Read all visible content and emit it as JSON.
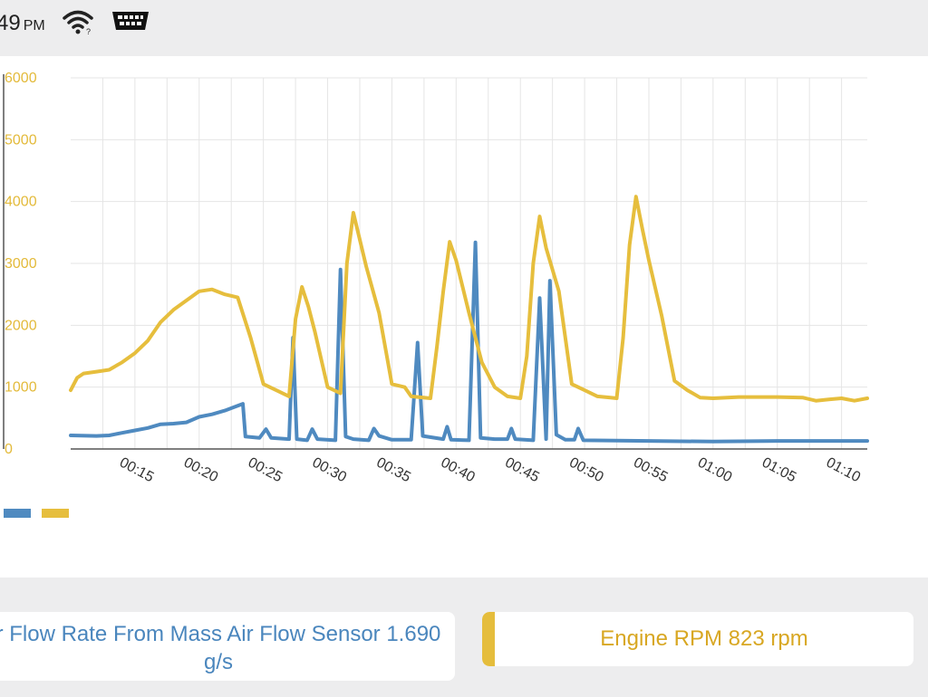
{
  "status_bar": {
    "time": "49",
    "ampm": "PM",
    "icons": [
      "wifi-icon",
      "obd-connector-icon"
    ]
  },
  "colors": {
    "maf": "#4f8ac0",
    "rpm": "#e6be3d",
    "rpm_text": "#d8a722",
    "maf_text": "#4a86bd",
    "grid": "#e5e5e5",
    "tick_text": "#e3ba3a"
  },
  "chart_data": {
    "type": "line",
    "x_ticks": [
      "00:15",
      "00:20",
      "00:25",
      "00:30",
      "00:35",
      "00:40",
      "00:45",
      "00:50",
      "00:55",
      "01:00",
      "01:05",
      "01:10"
    ],
    "y_ticks": [
      "0",
      "1000",
      "2000",
      "3000",
      "4000",
      "5000",
      "6000"
    ],
    "ylim": [
      0,
      6000
    ],
    "xlim": [
      "00:10",
      "01:12"
    ],
    "grid": true,
    "legend": "bottom-left",
    "series": [
      {
        "key": "maf",
        "points": [
          [
            "00:10",
            220
          ],
          [
            "00:12",
            210
          ],
          [
            "00:13",
            220
          ],
          [
            "00:14",
            260
          ],
          [
            "00:15",
            300
          ],
          [
            "00:16",
            340
          ],
          [
            "00:17",
            400
          ],
          [
            "00:18",
            410
          ],
          [
            "00:19",
            430
          ],
          [
            "00:20",
            520
          ],
          [
            "00:21",
            560
          ],
          [
            "00:22",
            620
          ],
          [
            "00:23",
            700
          ],
          [
            "00:23.4",
            730
          ],
          [
            "00:23.6",
            200
          ],
          [
            "00:24.7",
            180
          ],
          [
            "00:25.2",
            320
          ],
          [
            "00:25.6",
            180
          ],
          [
            "00:27",
            160
          ],
          [
            "00:27.3",
            1800
          ],
          [
            "00:27.6",
            160
          ],
          [
            "00:28.4",
            140
          ],
          [
            "00:28.8",
            320
          ],
          [
            "00:29.2",
            160
          ],
          [
            "00:30.6",
            140
          ],
          [
            "00:31",
            2900
          ],
          [
            "00:31.4",
            200
          ],
          [
            "00:32",
            160
          ],
          [
            "00:33.2",
            140
          ],
          [
            "00:33.6",
            330
          ],
          [
            "00:34",
            210
          ],
          [
            "00:35",
            150
          ],
          [
            "00:36.5",
            150
          ],
          [
            "00:37",
            1720
          ],
          [
            "00:37.4",
            210
          ],
          [
            "00:39",
            160
          ],
          [
            "00:39.3",
            360
          ],
          [
            "00:39.6",
            150
          ],
          [
            "00:41",
            140
          ],
          [
            "00:41.5",
            3340
          ],
          [
            "00:41.9",
            180
          ],
          [
            "00:43",
            160
          ],
          [
            "00:44",
            160
          ],
          [
            "00:44.3",
            330
          ],
          [
            "00:44.6",
            160
          ],
          [
            "00:46",
            140
          ],
          [
            "00:46.5",
            2440
          ],
          [
            "00:47",
            160
          ],
          [
            "00:47.3",
            2720
          ],
          [
            "00:47.8",
            230
          ],
          [
            "00:48.5",
            150
          ],
          [
            "00:49.2",
            150
          ],
          [
            "00:49.5",
            330
          ],
          [
            "00:49.9",
            140
          ],
          [
            "00:55",
            130
          ],
          [
            "01:00",
            120
          ],
          [
            "01:05",
            130
          ],
          [
            "01:12",
            130
          ]
        ]
      },
      {
        "key": "rpm",
        "points": [
          [
            "00:10",
            950
          ],
          [
            "00:10.5",
            1150
          ],
          [
            "00:11",
            1220
          ],
          [
            "00:12",
            1250
          ],
          [
            "00:13",
            1280
          ],
          [
            "00:14",
            1400
          ],
          [
            "00:15",
            1550
          ],
          [
            "00:16",
            1750
          ],
          [
            "00:17",
            2050
          ],
          [
            "00:18",
            2250
          ],
          [
            "00:19",
            2400
          ],
          [
            "00:20",
            2550
          ],
          [
            "00:21",
            2580
          ],
          [
            "00:22",
            2500
          ],
          [
            "00:23",
            2450
          ],
          [
            "00:24",
            1800
          ],
          [
            "00:25",
            1050
          ],
          [
            "00:26",
            950
          ],
          [
            "00:27",
            850
          ],
          [
            "00:27.5",
            2100
          ],
          [
            "00:28",
            2620
          ],
          [
            "00:28.5",
            2300
          ],
          [
            "00:29",
            1900
          ],
          [
            "00:30",
            1000
          ],
          [
            "00:31",
            900
          ],
          [
            "00:31.5",
            3000
          ],
          [
            "00:32",
            3820
          ],
          [
            "00:33",
            2950
          ],
          [
            "00:34",
            2200
          ],
          [
            "00:35",
            1050
          ],
          [
            "00:36",
            1000
          ],
          [
            "00:36.5",
            850
          ],
          [
            "00:38",
            820
          ],
          [
            "00:38.5",
            1650
          ],
          [
            "00:39",
            2550
          ],
          [
            "00:39.5",
            3350
          ],
          [
            "00:40",
            3050
          ],
          [
            "00:41",
            2200
          ],
          [
            "00:42",
            1400
          ],
          [
            "00:43",
            1000
          ],
          [
            "00:44",
            850
          ],
          [
            "00:45",
            820
          ],
          [
            "00:45.5",
            1500
          ],
          [
            "00:46",
            3000
          ],
          [
            "00:46.5",
            3760
          ],
          [
            "00:47",
            3250
          ],
          [
            "00:48",
            2550
          ],
          [
            "00:49",
            1050
          ],
          [
            "00:50",
            950
          ],
          [
            "00:51",
            850
          ],
          [
            "00:52",
            830
          ],
          [
            "00:52.5",
            820
          ],
          [
            "00:53",
            1800
          ],
          [
            "00:53.5",
            3300
          ],
          [
            "00:54",
            4080
          ],
          [
            "00:54.5",
            3550
          ],
          [
            "00:55",
            3050
          ],
          [
            "00:56",
            2150
          ],
          [
            "00:57",
            1100
          ],
          [
            "00:58",
            950
          ],
          [
            "00:59",
            830
          ],
          [
            "01:00",
            820
          ],
          [
            "01:02",
            840
          ],
          [
            "01:05",
            840
          ],
          [
            "01:07",
            830
          ],
          [
            "01:08",
            780
          ],
          [
            "01:09",
            800
          ],
          [
            "01:10",
            820
          ],
          [
            "01:11",
            780
          ],
          [
            "01:12",
            820
          ]
        ]
      }
    ]
  },
  "cards": {
    "maf": {
      "line1": "r Flow Rate From Mass Air Flow Sensor 1.690",
      "line2": "g/s"
    },
    "rpm": {
      "text": "Engine RPM 823 rpm"
    }
  }
}
